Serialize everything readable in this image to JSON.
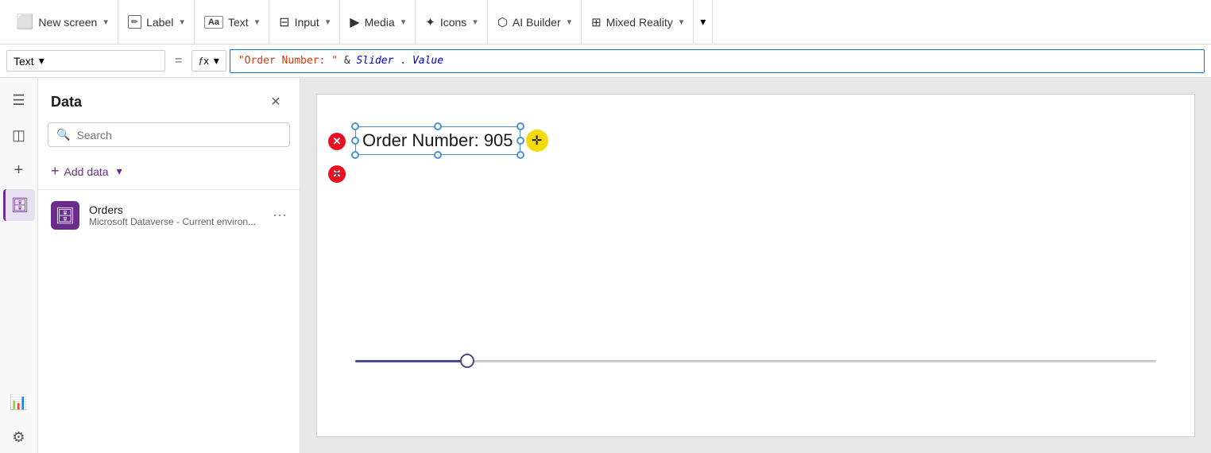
{
  "toolbar": {
    "new_screen_label": "New screen",
    "label_label": "Label",
    "text_label": "Text",
    "input_label": "Input",
    "media_label": "Media",
    "icons_label": "Icons",
    "ai_builder_label": "AI Builder",
    "mixed_reality_label": "Mixed Reality"
  },
  "formula_bar": {
    "dropdown_label": "Text",
    "equals_sign": "=",
    "fx_label": "fx",
    "formula_value": "\"Order Number: \" & Slider.Value"
  },
  "data_panel": {
    "title": "Data",
    "search_placeholder": "Search",
    "add_data_label": "Add data",
    "data_sources": [
      {
        "name": "Orders",
        "description": "Microsoft Dataverse - Current environ..."
      }
    ]
  },
  "canvas": {
    "text_content": "Order Number: 905"
  },
  "icons": {
    "menu": "☰",
    "layers": "◫",
    "database": "🗄",
    "chart": "📊",
    "settings": "⚙",
    "add": "+",
    "close": "✕",
    "search": "🔍",
    "chevron_down": "∨",
    "ellipsis": "⋯",
    "new_screen": "⬜",
    "label_icon": "✏",
    "text_icon": "Aa",
    "input_icon": "≡",
    "media_icon": "▶",
    "icons_icon": "✦",
    "ai_icon": "⬡",
    "mixed_reality_icon": "⊞",
    "error_x": "✕",
    "move_cross": "✛"
  }
}
